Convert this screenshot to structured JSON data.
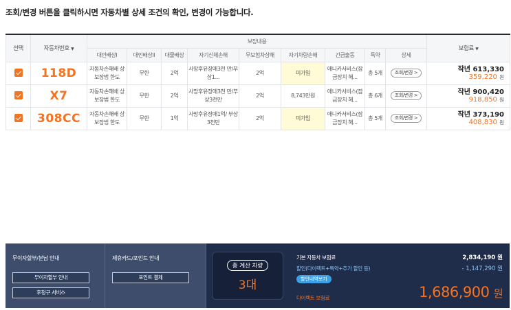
{
  "notice": "조회/변경 버튼을 클릭하시면 자동차별 상세 조건의 확인, 변경이 가능합니다.",
  "table": {
    "header_select": "선택",
    "header_car": "자동차번호",
    "header_coverage": "보장내용",
    "header_premium": "보험료",
    "sort_icon": "▼",
    "sub_headers": [
      "대인배상I",
      "대인배상II",
      "대물배상",
      "자기신체손해",
      "무보험차상해",
      "자기차량손해",
      "긴급출동",
      "특약",
      "상세"
    ],
    "rows": [
      {
        "car": "118D",
        "c1": "자동차손해배 상 보장법 한도",
        "c2": "무한",
        "c3": "2억",
        "c4": "사망후유장애3천 만/부상1...",
        "c5": "2억",
        "c6": "미가입",
        "c7": "애니카서비스(잠 금장치 해...",
        "c8": "총 5개",
        "detail": "조회/변경 >",
        "last_year": "작년 613,330",
        "current": "359,220",
        "won": "원"
      },
      {
        "car": "X7",
        "c1": "자동차손해배 상 보장법 한도",
        "c2": "무한",
        "c3": "2억",
        "c4": "사망후유장애3천 만/부상3천만",
        "c5": "2억",
        "c6": "8,743만원",
        "c7": "애니카서비스(잠 금장치 해...",
        "c8": "총 6개",
        "detail": "조회/변경 >",
        "last_year": "작년 900,420",
        "current": "918,850",
        "won": "원"
      },
      {
        "car": "308CC",
        "c1": "자동차손해배 상 보장법 한도",
        "c2": "무한",
        "c3": "1억",
        "c4": "사망후유장애1억/ 부상3천만",
        "c5": "2억",
        "c6": "미가입",
        "c7": "애니카서비스(잠 금장치 해...",
        "c8": "총 5개",
        "detail": "조회/변경 >",
        "last_year": "작년 373,190",
        "current": "408,830",
        "won": "원"
      }
    ]
  },
  "footer": {
    "installment_title": "무이자할부/분납 안내",
    "installment_btn": "무이자할부 안내",
    "claim_btn": "후청구 서비스",
    "card_title": "제휴카드/포인트 안내",
    "point_btn": "포인트 결제",
    "calc_label": "총 계산 차량",
    "calc_count": "3대",
    "base_label": "기본 자동차 보험료",
    "base_value": "2,834,190 원",
    "discount_label": "할인(다이렉트+특약+추가 할인 등)",
    "discount_value": "- 1,147,290 원",
    "discount_detail_btn": "할인내역보기",
    "direct_label": "다이렉트 보험료",
    "total_value": "1,686,900",
    "total_unit": "원"
  },
  "colors": {
    "accent": "#f37321",
    "footer_bg": "#3d4d6b",
    "footer_dark": "#1f2d4b",
    "highlight": "#fffbd6",
    "discount_text": "#8fc5f5",
    "discount_btn": "#3aa1e6"
  }
}
